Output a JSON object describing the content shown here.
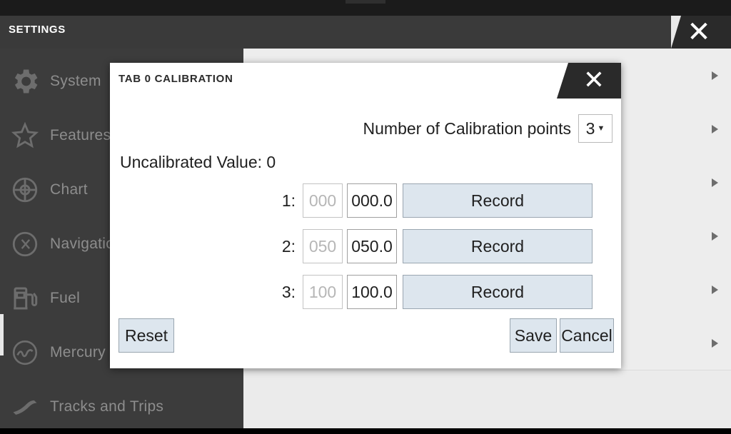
{
  "window": {
    "title": "SETTINGS",
    "close_icon": "close-icon"
  },
  "sidebar": {
    "items": [
      {
        "label": "System",
        "icon": "gear-icon"
      },
      {
        "label": "Features",
        "icon": "star-icon"
      },
      {
        "label": "Chart",
        "icon": "compass-icon"
      },
      {
        "label": "Navigation",
        "icon": "gauge-icon"
      },
      {
        "label": "Fuel",
        "icon": "fuel-pump-icon"
      },
      {
        "label": "Mercury",
        "icon": "mercury-icon"
      },
      {
        "label": "Tracks and Trips",
        "icon": "track-icon"
      }
    ]
  },
  "list_rows": {
    "count": 6,
    "arrow_icon": "chevron-right-icon"
  },
  "dialog": {
    "title": "TAB 0 CALIBRATION",
    "close_icon": "close-icon",
    "calibration_points": {
      "label": "Number of Calibration points",
      "value": "3",
      "caret_icon": "chevron-down-icon"
    },
    "uncalibrated_value_text": "Uncalibrated Value: 0",
    "rows": [
      {
        "index": "1:",
        "raw": "000",
        "value": "000.0",
        "record_label": "Record"
      },
      {
        "index": "2:",
        "raw": "050",
        "value": "050.0",
        "record_label": "Record"
      },
      {
        "index": "3:",
        "raw": "100",
        "value": "100.0",
        "record_label": "Record"
      }
    ],
    "reset_label": "Reset",
    "save_label": "Save",
    "cancel_label": "Cancel"
  },
  "colors": {
    "dialog_button": "#dde6ee",
    "sidebar_bg": "#3c3c3c",
    "titlebar_bg": "#3a3a3a"
  }
}
